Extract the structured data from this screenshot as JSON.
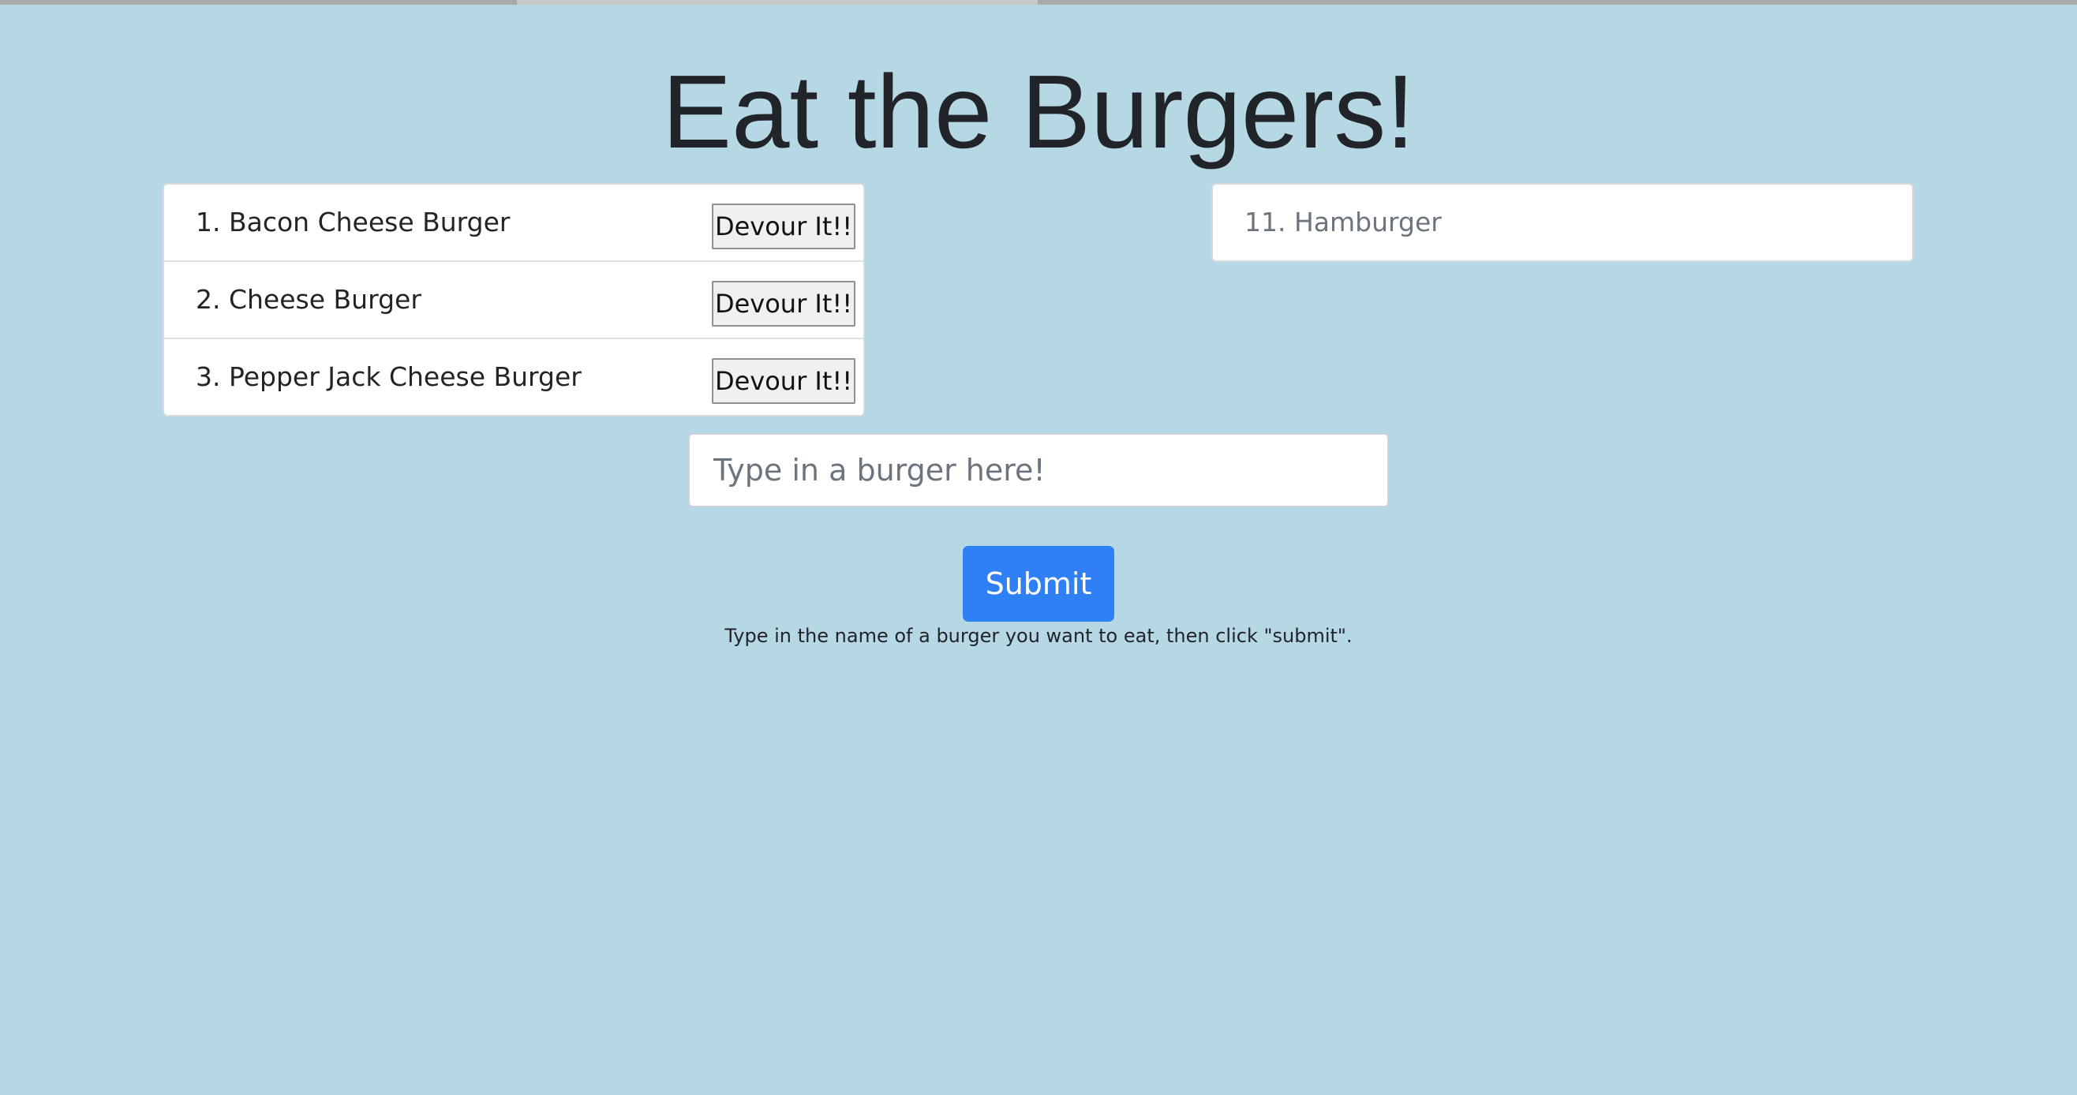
{
  "page": {
    "title": "Eat the Burgers!"
  },
  "uneaten": [
    {
      "label": "1. Bacon Cheese Burger",
      "button": "Devour It!!"
    },
    {
      "label": "2. Cheese Burger",
      "button": "Devour It!!"
    },
    {
      "label": "3. Pepper Jack Cheese Burger",
      "button": "Devour It!!"
    }
  ],
  "devoured": [
    {
      "label": "11. Hamburger"
    }
  ],
  "form": {
    "input_value": "",
    "placeholder": "Type in a burger here!",
    "submit_label": "Submit",
    "hint": "Type in the name of a burger you want to eat, then click \"submit\"."
  },
  "colors": {
    "background": "#b6d7e4",
    "primary": "#2f7ff5"
  }
}
